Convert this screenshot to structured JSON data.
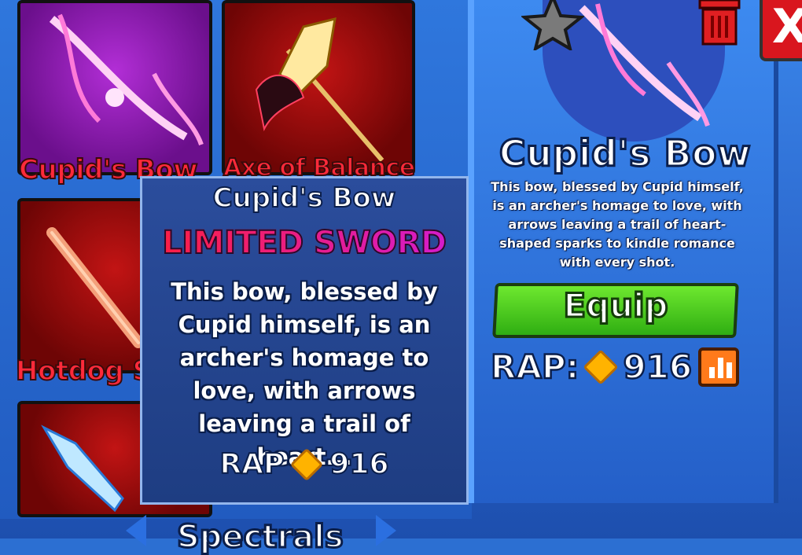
{
  "inventory": {
    "items": [
      {
        "name": "Cupid's Bow",
        "visible_name": "Cupid's Bow"
      },
      {
        "name": "Axe of Balance",
        "visible_name": "Axe of Balance"
      },
      {
        "name": "Hotdog S",
        "visible_name": "Hotdog S"
      }
    ]
  },
  "detail": {
    "title": "Cupid's Bow",
    "description": "This bow, blessed by Cupid himself, is an archer's homage to love, with arrows leaving a trail of heart-shaped sparks to kindle romance with every shot.",
    "equip_label": "Equip",
    "rap_label": "RAP:",
    "rap_value": "916",
    "close_label": "X"
  },
  "tooltip": {
    "title": "Cupid's Bow",
    "rarity": "LIMITED SWORD",
    "description": "This bow, blessed by Cupid himself, is an archer's homage to love, with arrows leaving a trail of heart...",
    "rap_label": "RAP",
    "rap_value": "916"
  },
  "footer": {
    "category_label": "Spectrals"
  },
  "colors": {
    "accent_blue": "#2c6fd2",
    "equip_green": "#4cc91f",
    "rarity_red": "#ff1f3a",
    "rarity_purple": "#d21bd6",
    "gem_gold": "#ffb300"
  }
}
